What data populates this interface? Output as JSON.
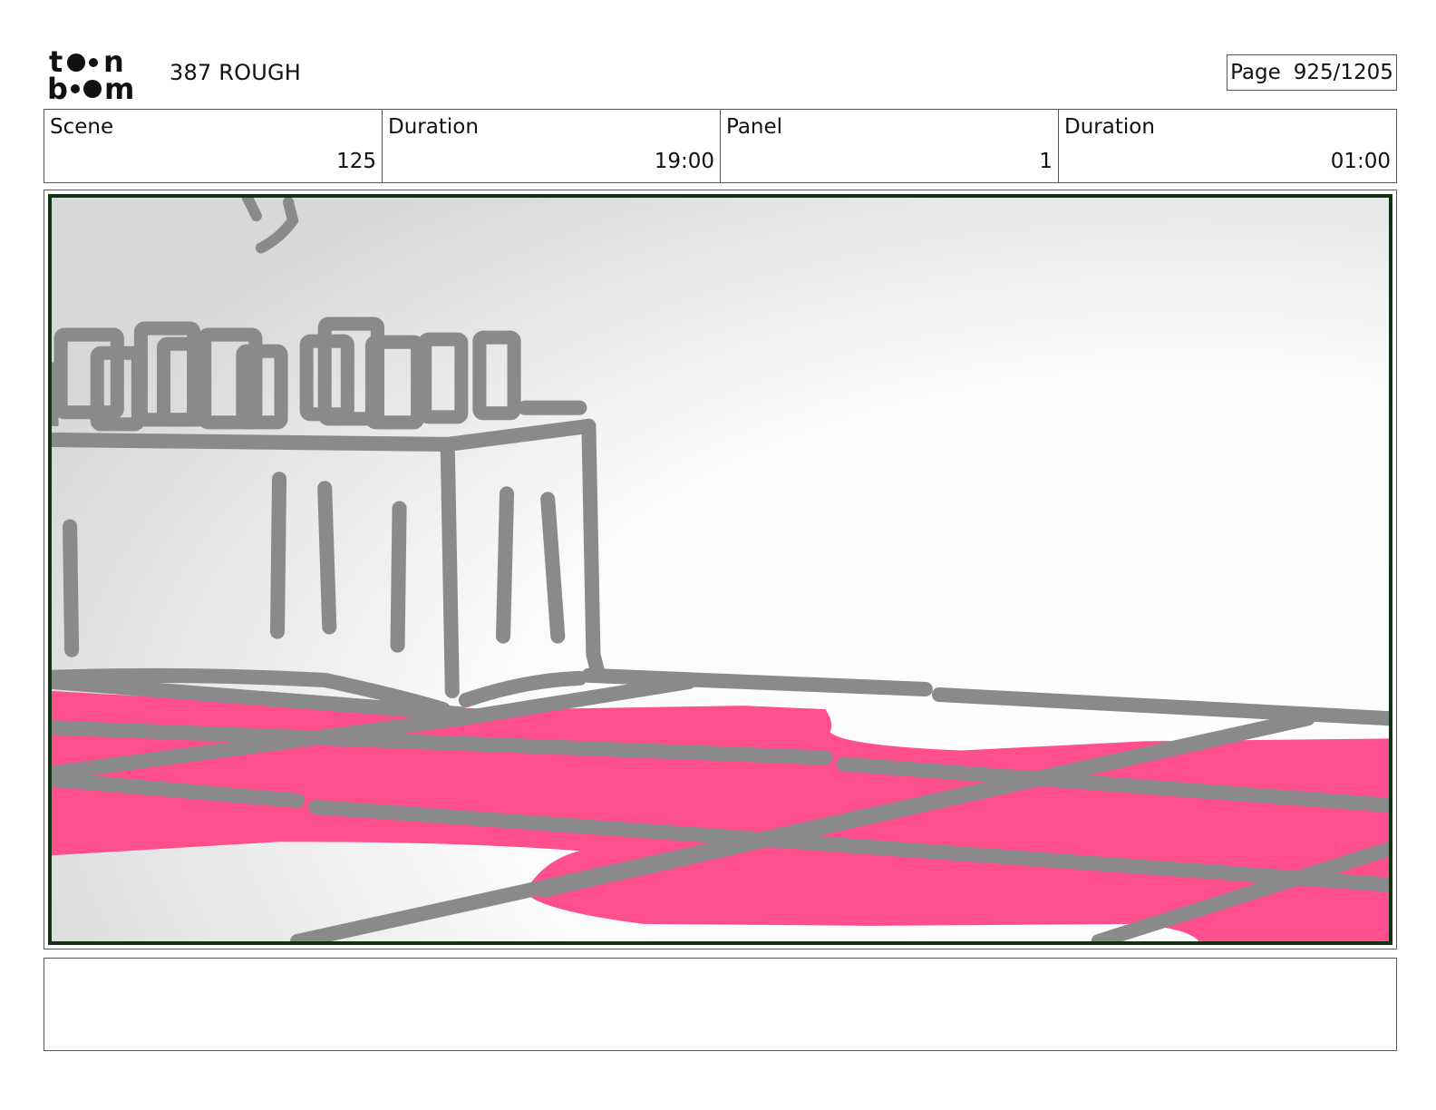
{
  "header": {
    "logo_text": "toonboom",
    "project_title": "387 ROUGH",
    "page_label": "Page",
    "page_value": "925/1205"
  },
  "info": {
    "scene_label": "Scene",
    "scene_value": "125",
    "scene_duration_label": "Duration",
    "scene_duration_value": "19:00",
    "panel_label": "Panel",
    "panel_value": "1",
    "panel_duration_label": "Duration",
    "panel_duration_value": "01:00"
  },
  "panel": {
    "colors": {
      "sketch_line": "#8a8a8a",
      "floor_fill": "#ff4f8f",
      "floor_overlap": "#8a2b4b",
      "frame_border": "#123112"
    }
  },
  "notes": {
    "text": ""
  }
}
